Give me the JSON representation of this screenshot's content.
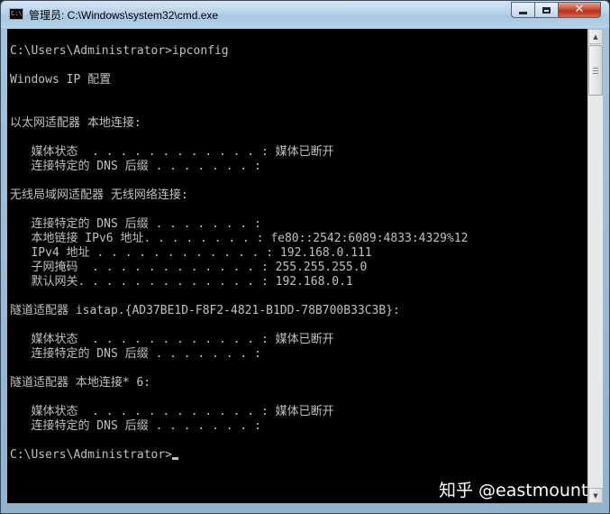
{
  "window": {
    "title": "管理员: C:\\Windows\\system32\\cmd.exe",
    "icon_label": "C:\\"
  },
  "controls": {
    "minimize": "minimize-icon",
    "maximize": "maximize-icon",
    "close": "✕"
  },
  "console": {
    "lines": [
      "C:\\Users\\Administrator>ipconfig",
      "",
      "Windows IP 配置",
      "",
      "",
      "以太网适配器 本地连接:",
      "",
      "   媒体状态  . . . . . . . . . . . . : 媒体已断开",
      "   连接特定的 DNS 后缀 . . . . . . . :",
      "",
      "无线局域网适配器 无线网络连接:",
      "",
      "   连接特定的 DNS 后缀 . . . . . . . :",
      "   本地链接 IPv6 地址. . . . . . . . : fe80::2542:6089:4833:4329%12",
      "   IPv4 地址 . . . . . . . . . . . . : 192.168.0.111",
      "   子网掩码  . . . . . . . . . . . . : 255.255.255.0",
      "   默认网关. . . . . . . . . . . . . : 192.168.0.1",
      "",
      "隧道适配器 isatap.{AD37BE1D-F8F2-4821-B1DD-78B700B33C3B}:",
      "",
      "   媒体状态  . . . . . . . . . . . . : 媒体已断开",
      "   连接特定的 DNS 后缀 . . . . . . . :",
      "",
      "隧道适配器 本地连接* 6:",
      "",
      "   媒体状态  . . . . . . . . . . . . : 媒体已断开",
      "   连接特定的 DNS 后缀 . . . . . . . :",
      "",
      "C:\\Users\\Administrator>"
    ],
    "text_color": "#c0c0c0",
    "background": "#000000"
  },
  "watermark": "知乎 @eastmount"
}
